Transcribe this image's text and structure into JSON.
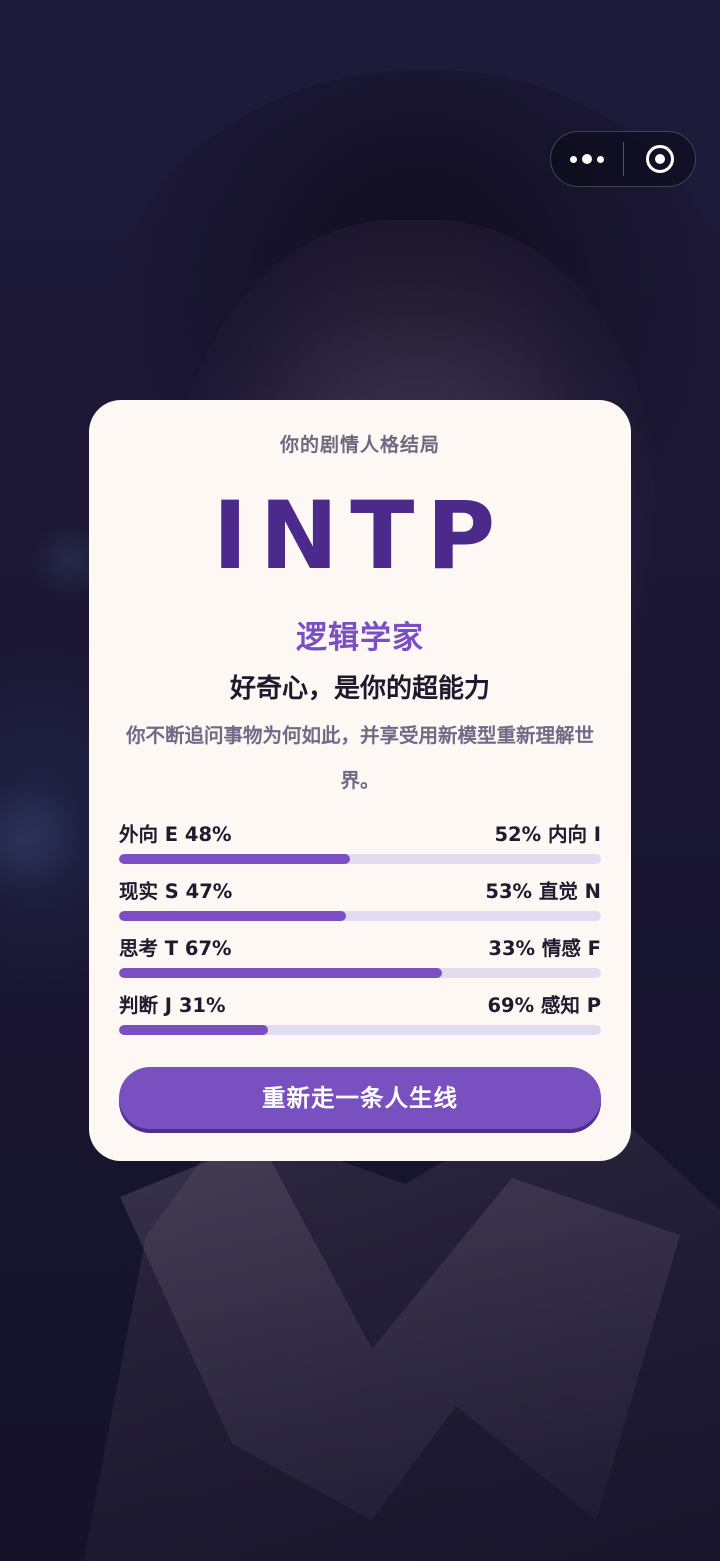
{
  "capsule": {
    "more_icon": "more-dots-icon",
    "close_icon": "target-close-icon"
  },
  "result": {
    "subtitle": "你的剧情人格结局",
    "type_code": "INTP",
    "type_name": "逻辑学家",
    "tagline": "好奇心，是你的超能力",
    "description": "你不断追问事物为何如此，并享受用新模型重新理解世界。"
  },
  "dimensions": [
    {
      "left_label": "外向 E  48%",
      "right_label": "52%  内向 I",
      "left_percent": 48
    },
    {
      "left_label": "现实 S  47%",
      "right_label": "53%  直觉 N",
      "left_percent": 47
    },
    {
      "left_label": "思考 T  67%",
      "right_label": "33%  情感 F",
      "left_percent": 67
    },
    {
      "left_label": "判断 J  31%",
      "right_label": "69%  感知 P",
      "left_percent": 31
    }
  ],
  "cta": {
    "label": "重新走一条人生线"
  },
  "colors": {
    "accent": "#7850c0",
    "type_code": "#4b2a8c",
    "card_bg": "#fdf8f3",
    "track": "#e2dcf0"
  }
}
